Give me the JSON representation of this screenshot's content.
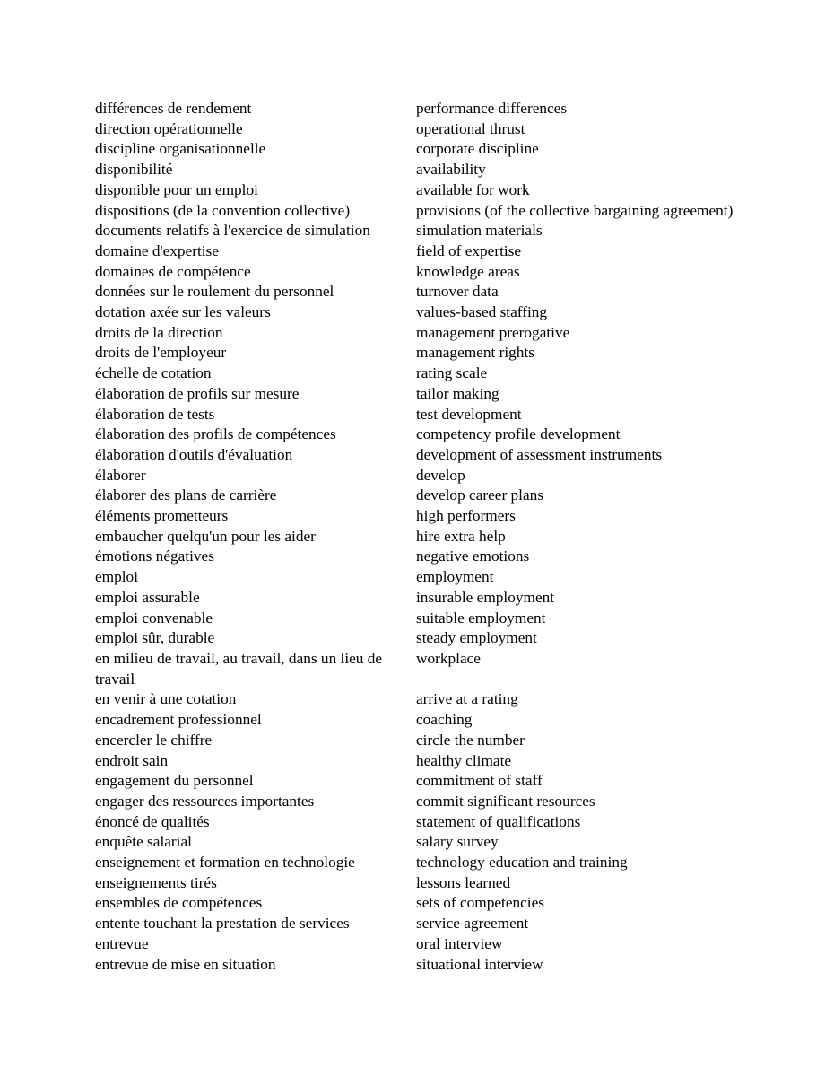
{
  "document": {
    "type": "bilingual-glossary",
    "language_left": "français",
    "language_right": "english",
    "background_color": "#ffffff",
    "text_color": "#000000"
  },
  "entries": [
    {
      "fr": "différences de rendement",
      "en": "performance differences"
    },
    {
      "fr": "direction opérationnelle",
      "en": "operational thrust"
    },
    {
      "fr": "discipline organisationnelle",
      "en": "corporate discipline"
    },
    {
      "fr": "disponibilité",
      "en": "availability"
    },
    {
      "fr": "disponible pour un emploi",
      "en": "available for work"
    },
    {
      "fr": "dispositions (de la convention collective)",
      "en": "provisions (of the collective bargaining agreement)"
    },
    {
      "fr": "documents relatifs à l'exercice de simulation",
      "en": "simulation materials"
    },
    {
      "fr": "domaine d'expertise",
      "en": "field of expertise"
    },
    {
      "fr": "domaines de compétence",
      "en": "knowledge areas"
    },
    {
      "fr": "données sur le roulement du personnel",
      "en": "turnover data"
    },
    {
      "fr": "dotation axée sur les valeurs",
      "en": "values-based staffing"
    },
    {
      "fr": "droits de la direction",
      "en": "management prerogative"
    },
    {
      "fr": "droits de l'employeur",
      "en": "management rights"
    },
    {
      "fr": "échelle de cotation",
      "en": "rating scale"
    },
    {
      "fr": "élaboration de profils sur mesure",
      "en": "tailor making"
    },
    {
      "fr": "élaboration de tests",
      "en": "test development"
    },
    {
      "fr": "élaboration des profils de compétences",
      "en": "competency profile development"
    },
    {
      "fr": "élaboration d'outils d'évaluation",
      "en": "development of assessment instruments"
    },
    {
      "fr": "élaborer",
      "en": "develop"
    },
    {
      "fr": "élaborer des plans de carrière",
      "en": "develop career plans"
    },
    {
      "fr": "éléments prometteurs",
      "en": "high performers"
    },
    {
      "fr": "embaucher quelqu'un pour les aider",
      "en": "hire extra help"
    },
    {
      "fr": "émotions négatives",
      "en": "negative emotions"
    },
    {
      "fr": "emploi",
      "en": "employment"
    },
    {
      "fr": "emploi assurable",
      "en": "insurable employment"
    },
    {
      "fr": "emploi convenable",
      "en": "suitable employment"
    },
    {
      "fr": "emploi sûr, durable",
      "en": "steady employment"
    },
    {
      "fr": "en milieu de travail, au travail, dans un lieu de travail",
      "en": "workplace"
    },
    {
      "fr": "en venir à une cotation",
      "en": "arrive at a rating"
    },
    {
      "fr": "encadrement professionnel",
      "en": "coaching"
    },
    {
      "fr": "encercler le chiffre",
      "en": "circle the number"
    },
    {
      "fr": "endroit sain",
      "en": "healthy climate"
    },
    {
      "fr": "engagement du personnel",
      "en": "commitment of staff"
    },
    {
      "fr": "engager des ressources importantes",
      "en": "commit significant resources"
    },
    {
      "fr": "énoncé de qualités",
      "en": "statement of qualifications"
    },
    {
      "fr": "enquête salarial",
      "en": "salary survey"
    },
    {
      "fr": "enseignement et formation en technologie",
      "en": "technology education and training"
    },
    {
      "fr": "enseignements tirés",
      "en": "lessons learned"
    },
    {
      "fr": "ensembles de compétences",
      "en": "sets of competencies"
    },
    {
      "fr": "entente touchant la prestation de services",
      "en": "service agreement"
    },
    {
      "fr": "entrevue",
      "en": "oral interview"
    },
    {
      "fr": "entrevue de mise en situation",
      "en": "situational interview"
    }
  ]
}
